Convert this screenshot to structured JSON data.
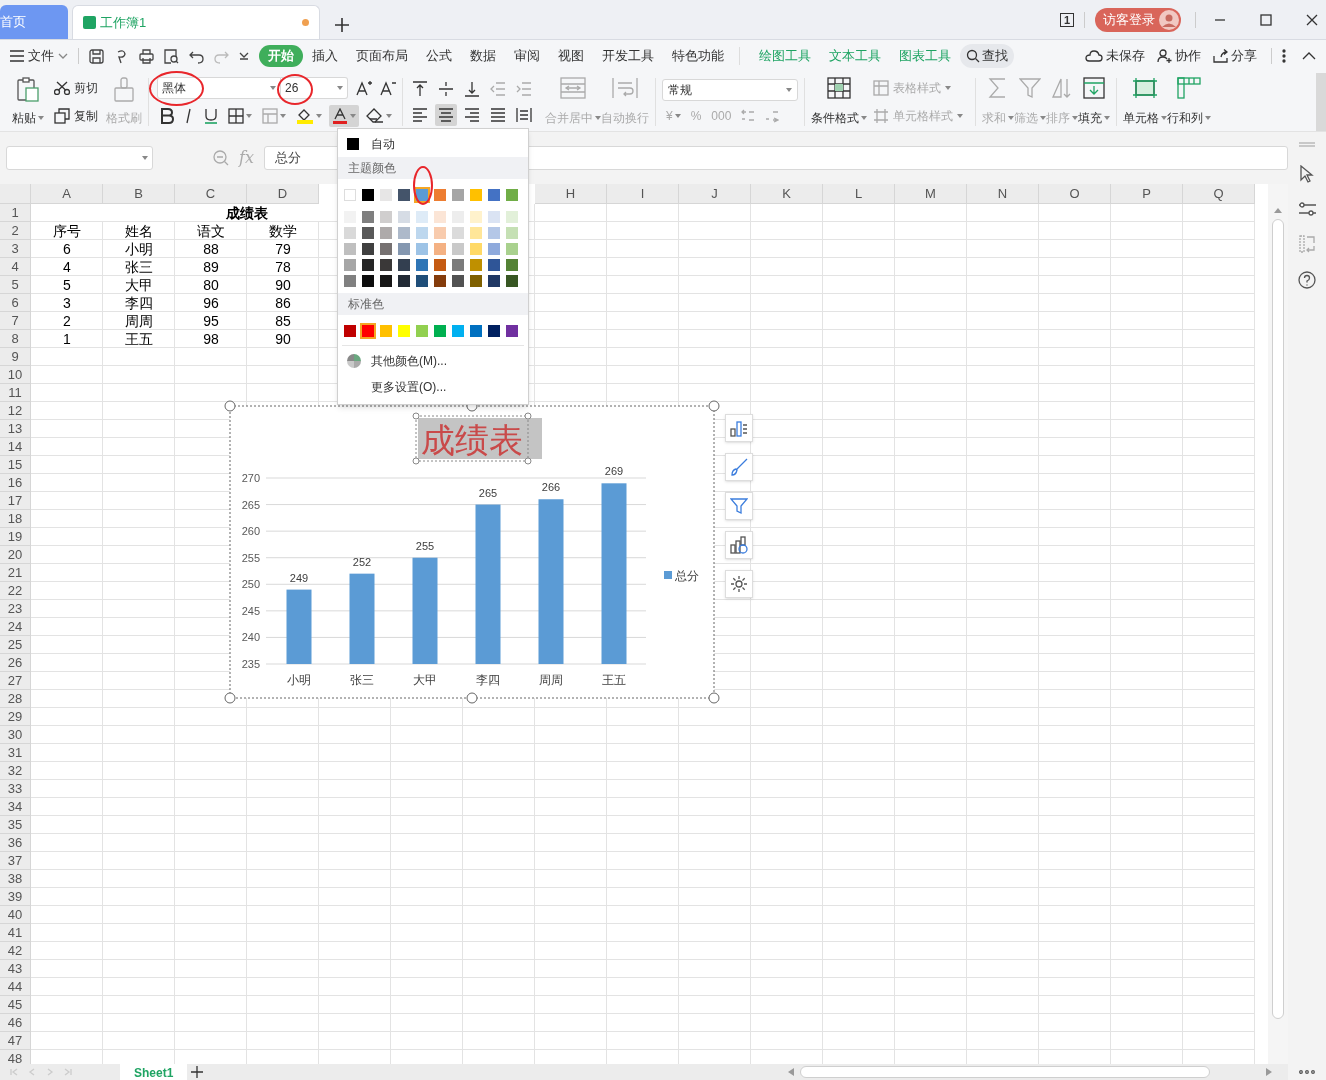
{
  "window": {
    "tabs": [
      {
        "label": "首页",
        "kind": "home",
        "selected": false
      },
      {
        "label": "工作簿1",
        "kind": "sheet",
        "selected": true,
        "unsaved": true
      }
    ],
    "window_count": "1",
    "login": "访客登录"
  },
  "menu": {
    "file": "文件",
    "tabs": [
      {
        "label": "开始",
        "kind": "main",
        "selected": true
      },
      {
        "label": "插入",
        "kind": "main",
        "selected": false
      },
      {
        "label": "页面布局",
        "kind": "main",
        "selected": false
      },
      {
        "label": "公式",
        "kind": "main",
        "selected": false
      },
      {
        "label": "数据",
        "kind": "main",
        "selected": false
      },
      {
        "label": "审阅",
        "kind": "main",
        "selected": false
      },
      {
        "label": "视图",
        "kind": "main",
        "selected": false
      },
      {
        "label": "开发工具",
        "kind": "main",
        "selected": false
      },
      {
        "label": "特色功能",
        "kind": "main",
        "selected": false
      },
      {
        "label": "绘图工具",
        "kind": "context",
        "selected": false
      },
      {
        "label": "文本工具",
        "kind": "context",
        "selected": false
      },
      {
        "label": "图表工具",
        "kind": "context",
        "selected": false
      }
    ],
    "search": "查找",
    "unsaved": "未保存",
    "collab": "协作",
    "share": "分享"
  },
  "ribbon": {
    "paste": {
      "label": "粘贴",
      "disabled": false
    },
    "cut": {
      "label": "剪切",
      "disabled": false
    },
    "copy": {
      "label": "复制",
      "disabled": false
    },
    "format_painter": {
      "label": "格式刷",
      "disabled": true
    },
    "font_name": "黑体",
    "font_size": "26",
    "format_buttons": [
      {
        "pressed": false
      },
      {
        "pressed": false
      },
      {
        "pressed": false
      },
      {
        "pressed": false
      },
      {
        "pressed": false
      },
      {
        "pressed": false
      },
      {
        "pressed": true
      },
      {
        "pressed": false
      }
    ],
    "align_buttons": [
      {
        "pressed": false,
        "disabled": false
      },
      {
        "pressed": false,
        "disabled": false
      },
      {
        "pressed": false,
        "disabled": false
      },
      {
        "pressed": false,
        "disabled": true
      },
      {
        "pressed": false,
        "disabled": true
      },
      {
        "pressed": false,
        "disabled": false
      },
      {
        "pressed": true,
        "disabled": false
      },
      {
        "pressed": false,
        "disabled": false
      },
      {
        "pressed": false,
        "disabled": false
      },
      {
        "pressed": false,
        "disabled": false
      }
    ],
    "merge": {
      "label": "合并居中",
      "disabled": true
    },
    "wrap": {
      "label": "自动换行",
      "disabled": true
    },
    "number_format": "常规",
    "number_buttons": [
      {
        "label": "¥"
      },
      {
        "label": "%"
      },
      {
        "label": "000"
      }
    ],
    "conditional": {
      "label": "条件格式",
      "disabled": false
    },
    "table_style": {
      "label": "表格样式",
      "disabled": true
    },
    "cell_style": {
      "label": "单元格样式",
      "disabled": true
    },
    "sum": {
      "label": "求和",
      "disabled": true
    },
    "filter": {
      "label": "筛选",
      "disabled": true
    },
    "sort": {
      "label": "排序",
      "disabled": true
    },
    "fill": {
      "label": "填充",
      "disabled": false
    },
    "cell": {
      "label": "单元格",
      "disabled": false
    },
    "rowcol": {
      "label": "行和列",
      "disabled": false
    }
  },
  "formula_bar": {
    "fx": "fx",
    "value": "总分"
  },
  "sheet": {
    "columns": [
      "A",
      "B",
      "C",
      "D",
      null,
      null,
      null,
      "H",
      "I",
      "J",
      "K",
      "L",
      "M",
      "N",
      "O",
      "P",
      "Q"
    ],
    "row_numbers": [
      "1",
      "2",
      "3",
      "4",
      "5",
      "6",
      "7",
      "8",
      "9",
      "10",
      "11",
      "12",
      "13",
      "14",
      "15",
      "16",
      "17",
      "18",
      "19",
      "20",
      "21",
      "22",
      "23",
      "24",
      "25",
      "26",
      "27",
      "28",
      "29",
      "30",
      "31",
      "32",
      "33",
      "34",
      "35",
      "36",
      "37",
      "38",
      "39",
      "40",
      "41",
      "42",
      "43",
      "44",
      "45",
      "46",
      "47",
      "48"
    ],
    "title": {
      "text": "成绩表"
    },
    "rows": [
      [
        "序号",
        "姓名",
        "语文",
        "数学"
      ],
      [
        "6",
        "小明",
        "88",
        "79"
      ],
      [
        "4",
        "张三",
        "89",
        "78"
      ],
      [
        "5",
        "大甲",
        "80",
        "90"
      ],
      [
        "3",
        "李四",
        "96",
        "86"
      ],
      [
        "2",
        "周周",
        "95",
        "85"
      ],
      [
        "1",
        "王五",
        "98",
        "90"
      ]
    ]
  },
  "chart": {
    "chart_data": {
      "type": "bar",
      "title": "成绩表",
      "categories": [
        "小明",
        "张三",
        "大甲",
        "李四",
        "周周",
        "王五"
      ],
      "series": [
        {
          "name": "总分",
          "color": "#5b9bd5",
          "values": [
            249,
            252,
            255,
            265,
            266,
            269
          ]
        }
      ],
      "ylim": [
        235,
        270
      ],
      "yticks": [
        235,
        240,
        245,
        250,
        255,
        260,
        265,
        270
      ],
      "data_labels": true,
      "grid": true
    }
  },
  "color_menu": {
    "auto": "自动",
    "theme_header": "主题颜色",
    "theme": [
      {
        "color": "#ffffff",
        "selected": false
      },
      {
        "color": "#000000",
        "selected": false
      },
      {
        "color": "#e7e6e6",
        "selected": false
      },
      {
        "color": "#44546a",
        "selected": false
      },
      {
        "color": "#5b9bd5",
        "selected": true
      },
      {
        "color": "#ed7d31",
        "selected": false
      },
      {
        "color": "#a5a5a5",
        "selected": false
      },
      {
        "color": "#ffc000",
        "selected": false
      },
      {
        "color": "#4472c4",
        "selected": false
      },
      {
        "color": "#70ad47",
        "selected": false
      }
    ],
    "shades": [
      [
        {
          "color": "#f2f2f2"
        },
        {
          "color": "#7f7f7f"
        },
        {
          "color": "#d0cece"
        },
        {
          "color": "#d6dce5"
        },
        {
          "color": "#deebf7"
        },
        {
          "color": "#fbe5d6"
        },
        {
          "color": "#ededed"
        },
        {
          "color": "#fff2cc"
        },
        {
          "color": "#dae3f3"
        },
        {
          "color": "#e2f0d9"
        }
      ],
      [
        {
          "color": "#d9d9d9"
        },
        {
          "color": "#595959"
        },
        {
          "color": "#aeaaaa"
        },
        {
          "color": "#adb9ca"
        },
        {
          "color": "#bdd7ee"
        },
        {
          "color": "#f8cbad"
        },
        {
          "color": "#dbdbdb"
        },
        {
          "color": "#ffe699"
        },
        {
          "color": "#b4c7e7"
        },
        {
          "color": "#c5e0b4"
        }
      ],
      [
        {
          "color": "#bfbfbf"
        },
        {
          "color": "#404040"
        },
        {
          "color": "#767171"
        },
        {
          "color": "#8497b0"
        },
        {
          "color": "#9dc3e6"
        },
        {
          "color": "#f4b183"
        },
        {
          "color": "#c9c9c9"
        },
        {
          "color": "#ffd966"
        },
        {
          "color": "#8faadc"
        },
        {
          "color": "#a9d18e"
        }
      ],
      [
        {
          "color": "#a6a6a6"
        },
        {
          "color": "#262626"
        },
        {
          "color": "#3a3838"
        },
        {
          "color": "#333f50"
        },
        {
          "color": "#2e75b6"
        },
        {
          "color": "#c55a11"
        },
        {
          "color": "#7b7b7b"
        },
        {
          "color": "#bf9000"
        },
        {
          "color": "#2f5597"
        },
        {
          "color": "#548235"
        }
      ],
      [
        {
          "color": "#808080"
        },
        {
          "color": "#0d0d0d"
        },
        {
          "color": "#171616"
        },
        {
          "color": "#222a35"
        },
        {
          "color": "#1f4e79"
        },
        {
          "color": "#843c0c"
        },
        {
          "color": "#525252"
        },
        {
          "color": "#7f6000"
        },
        {
          "color": "#203864"
        },
        {
          "color": "#385723"
        }
      ]
    ],
    "standard_header": "标准色",
    "standard": [
      {
        "color": "#c00000",
        "selected": false
      },
      {
        "color": "#ff0000",
        "selected": true
      },
      {
        "color": "#ffc000",
        "selected": false
      },
      {
        "color": "#ffff00",
        "selected": false
      },
      {
        "color": "#92d050",
        "selected": false
      },
      {
        "color": "#00b050",
        "selected": false
      },
      {
        "color": "#00b0f0",
        "selected": false
      },
      {
        "color": "#0070c0",
        "selected": false
      },
      {
        "color": "#002060",
        "selected": false
      },
      {
        "color": "#7030a0",
        "selected": false
      }
    ],
    "more_colors": "其他颜色(M)...",
    "more_settings": "更多设置(O)..."
  },
  "sheet_tabs": [
    {
      "label": "Sheet1",
      "selected": true
    }
  ]
}
